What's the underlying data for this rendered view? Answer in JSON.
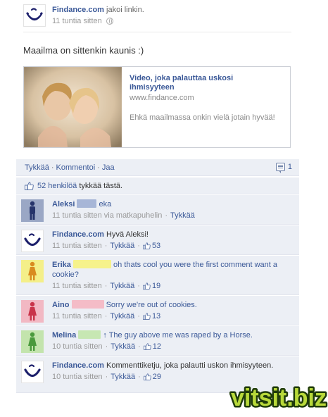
{
  "post": {
    "poster_name": "Findance.com",
    "action": "jakoi linkin.",
    "time": "11 tuntia sitten",
    "message": "Maailma on sittenkin kaunis :)"
  },
  "attachment": {
    "title": "Video, joka palauttaa uskosi ihmisyyteen",
    "url": "www.findance.com",
    "description": "Ehkä maailmassa onkin vielä jotain hyvää!"
  },
  "actions": {
    "like": "Tykkää",
    "comment": "Kommentoi",
    "share": "Jaa",
    "separator": "·",
    "comment_count": "1"
  },
  "likes": {
    "count_text": "52 henkilöä",
    "suffix": " tykkää tästä."
  },
  "comments": [
    {
      "author": "Aleksi",
      "text": "eka",
      "time": "11 tuntia sitten via matkapuhelin",
      "like": "Tykkää",
      "likes": "",
      "redact_color": "#a7b6d7",
      "avatar_bg": "#9aa7c5",
      "figure_color": "#26346b"
    },
    {
      "author": "Findance.com",
      "text": "Hyvä Aleksi!",
      "time": "11 tuntia sitten",
      "like": "Tykkää",
      "likes": "53"
    },
    {
      "author": "Erika",
      "text": "oh thats cool you were the first comment want a cookie?",
      "time": "11 tuntia sitten",
      "like": "Tykkää",
      "likes": "19",
      "redact_color": "#f6f28b",
      "avatar_bg": "#f4ef89",
      "figure_color": "#d98b1f"
    },
    {
      "author": "Aino",
      "text": "Sorry we're out of cookies.",
      "time": "11 tuntia sitten",
      "like": "Tykkää",
      "likes": "13",
      "redact_color": "#f4bcc7",
      "avatar_bg": "#f2b8c3",
      "figure_color": "#c9344a"
    },
    {
      "author": "Melina",
      "text": "↑ The guy above me was raped by a Horse.",
      "time": "10 tuntia sitten",
      "like": "Tykkää",
      "likes": "12",
      "redact_color": "#c7e7b3",
      "avatar_bg": "#c3e4ad",
      "figure_color": "#4a9a3d"
    },
    {
      "author": "Findance.com",
      "text": "Kommenttiketju, joka palautti uskon ihmisyyteen.",
      "time": "10 tuntia sitten",
      "like": "Tykkää",
      "likes": "29"
    }
  ],
  "watermark": "vitsit.biz",
  "colors": {
    "link": "#3b5998",
    "comment_bg": "#eceff5",
    "watermark_fill": "#b8d93a",
    "watermark_stroke": "#1f3b0a"
  }
}
